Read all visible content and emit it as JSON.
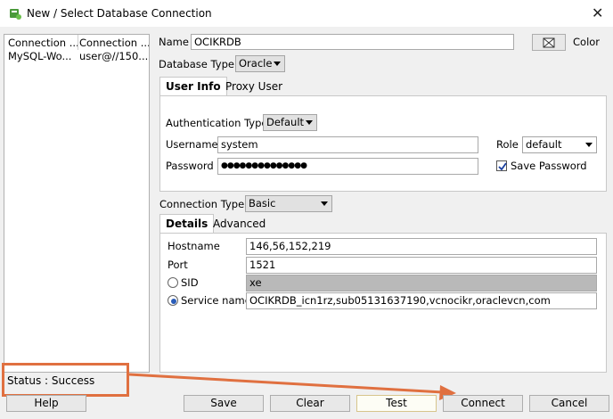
{
  "window": {
    "title": "New / Select Database Connection"
  },
  "connections": {
    "headers": [
      "Connection ...",
      "Connection ..."
    ],
    "rows": [
      {
        "name": "MySQL-Wo...",
        "details": "user@//150...."
      }
    ]
  },
  "form": {
    "name_label": "Name",
    "name_value": "OCIKRDB",
    "color_label": "Color",
    "db_type_label": "Database Type",
    "db_type_value": "Oracle",
    "tabs": {
      "user_info": "User Info",
      "proxy_user": "Proxy User"
    },
    "auth_type_label": "Authentication Type",
    "auth_type_value": "Default",
    "username_label": "Username",
    "username_value": "system",
    "password_label": "Password",
    "password_value": "●●●●●●●●●●●●●●",
    "role_label": "Role",
    "role_value": "default",
    "save_password_label": "Save Password",
    "save_password_checked": true,
    "conn_type_label": "Connection Type",
    "conn_type_value": "Basic",
    "subtabs": {
      "details": "Details",
      "advanced": "Advanced"
    },
    "hostname_label": "Hostname",
    "hostname_value": "146,56,152,219",
    "port_label": "Port",
    "port_value": "1521",
    "sid_label": "SID",
    "sid_value": "xe",
    "service_name_label": "Service name",
    "service_name_value": "OCIKRDB_icn1rz,sub05131637190,vcnocikr,oraclevcn,com",
    "service_name_selected": true
  },
  "status": {
    "text": "Status : Success"
  },
  "buttons": {
    "help": "Help",
    "save": "Save",
    "clear": "Clear",
    "test": "Test",
    "connect": "Connect",
    "cancel": "Cancel"
  },
  "colors": {
    "accent": "#2a5cb8",
    "annotation": "#e07040"
  }
}
